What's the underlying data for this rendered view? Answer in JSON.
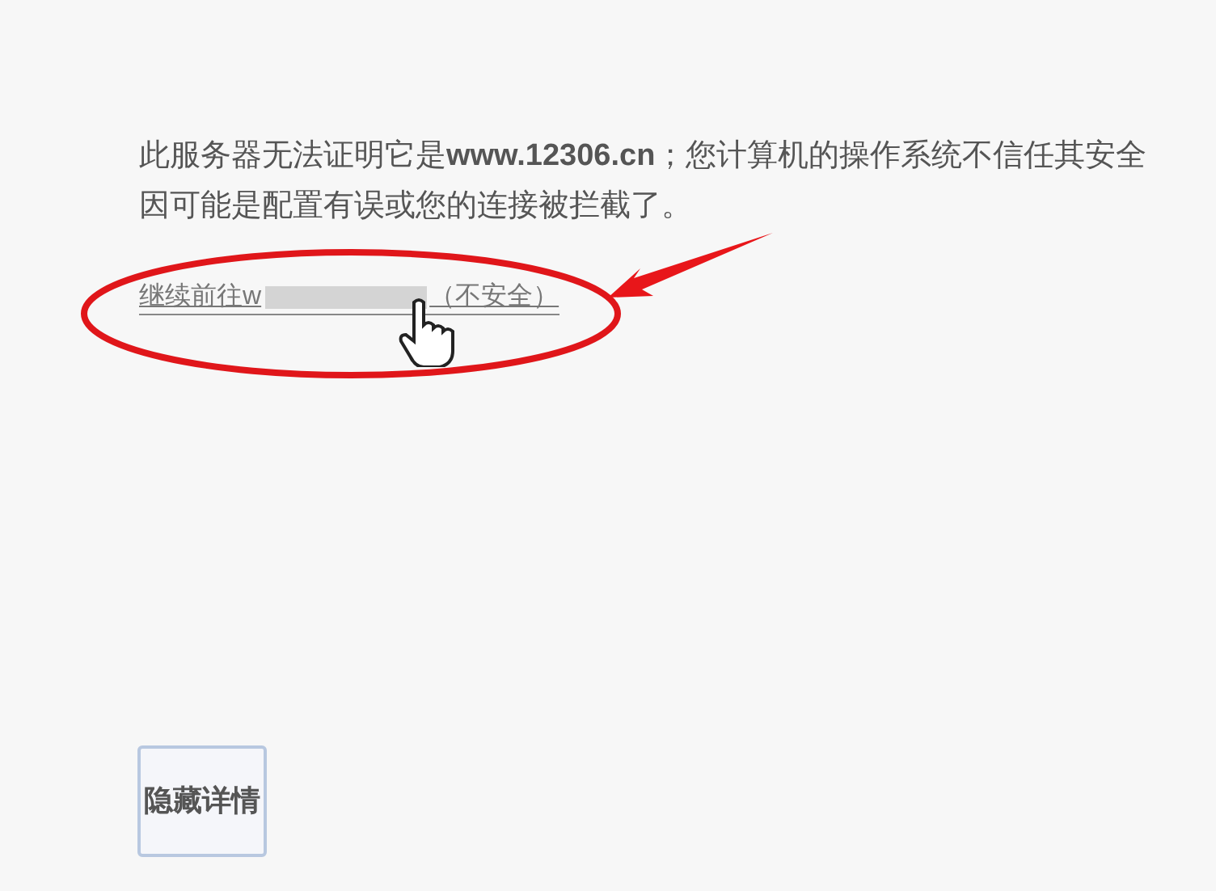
{
  "message": {
    "lines": [
      "此服务器无法证明它是**www.12306.cn**；您计算机的操作系统不信任其安全",
      "因可能是配置有误或您的连接被拦截了。"
    ]
  },
  "proceed_link": {
    "prefix": "继续前往w",
    "suffix": "（不安全）"
  },
  "details_button": {
    "label": "隐藏详情"
  }
}
